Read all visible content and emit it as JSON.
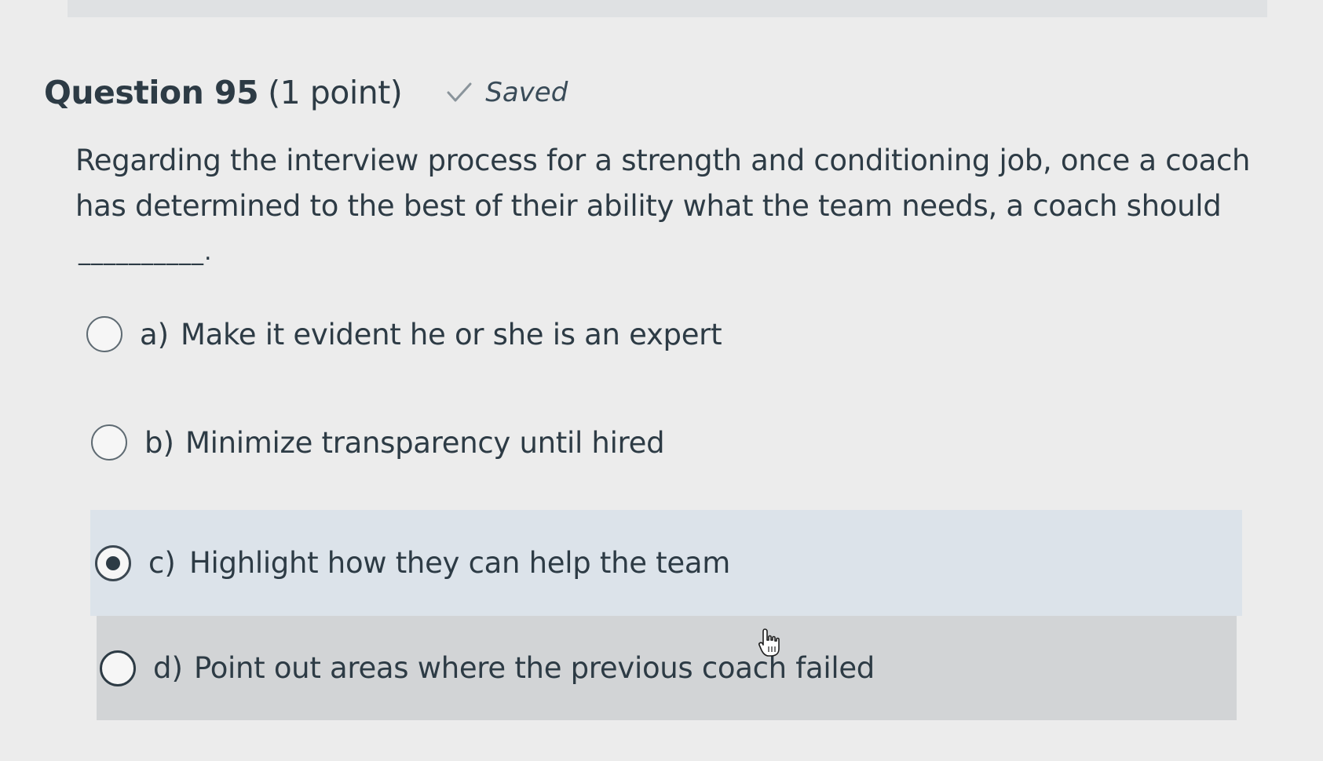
{
  "question": {
    "title": "Question 95",
    "points": "(1 point)",
    "status": "Saved",
    "status_icon": "checkmark-icon",
    "text": "Regarding the interview process for a strength and conditioning job, once a coach has determined to the best of their ability what the team needs, a coach should",
    "blank": "__________."
  },
  "answers": [
    {
      "letter": "a)",
      "text": "Make it evident he or she is an expert",
      "selected": false
    },
    {
      "letter": "b)",
      "text": "Minimize transparency until hired",
      "selected": false
    },
    {
      "letter": "c)",
      "text": "Highlight how they can help the team",
      "selected": true
    },
    {
      "letter": "d)",
      "text": "Point out areas where the previous coach failed",
      "selected": false
    }
  ],
  "colors": {
    "background": "#ececec",
    "text": "#2d3b45",
    "selected_row": "#dce3ea",
    "hovered_row": "#d2d4d6"
  }
}
